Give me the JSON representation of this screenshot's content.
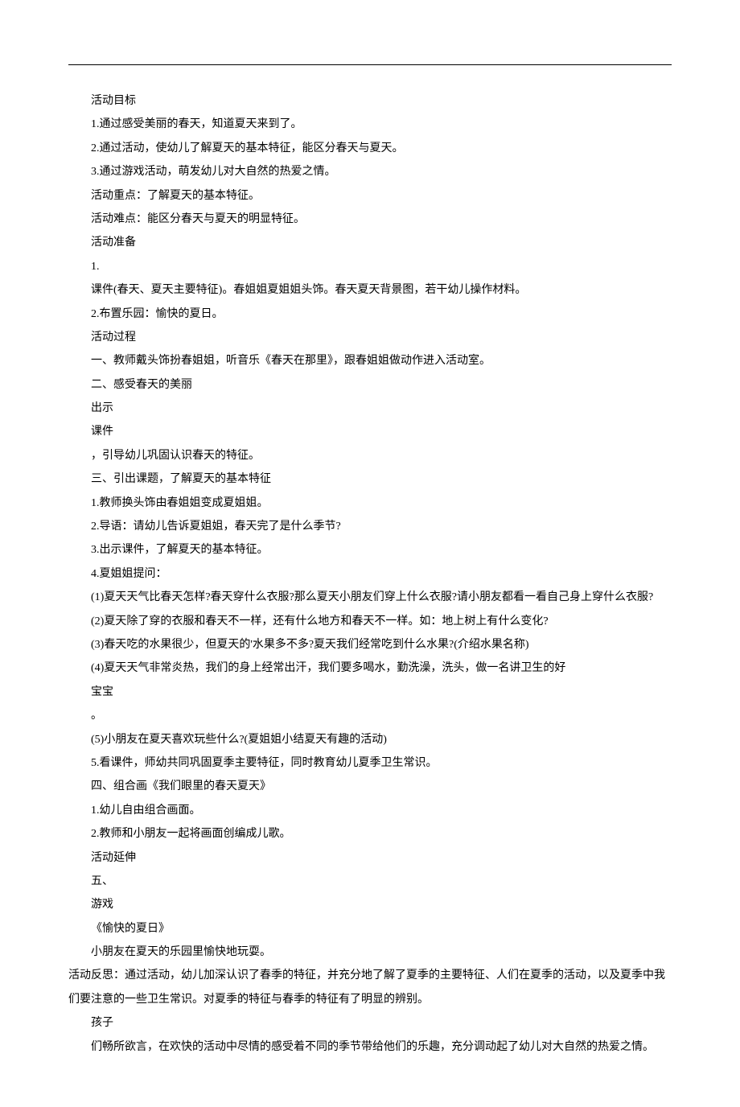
{
  "lines": [
    {
      "indent": true,
      "text": "活动目标"
    },
    {
      "indent": true,
      "text": "1.通过感受美丽的春天，知道夏天来到了。"
    },
    {
      "indent": true,
      "text": "2.通过活动，使幼儿了解夏天的基本特征，能区分春天与夏天。"
    },
    {
      "indent": true,
      "text": "3.通过游戏活动，萌发幼儿对大自然的热爱之情。"
    },
    {
      "indent": true,
      "text": "活动重点：了解夏天的基本特征。"
    },
    {
      "indent": true,
      "text": "活动难点：能区分春天与夏天的明显特征。"
    },
    {
      "indent": true,
      "text": "活动准备"
    },
    {
      "indent": true,
      "text": "1."
    },
    {
      "indent": true,
      "text": "课件(春天、夏天主要特征)。春姐姐夏姐姐头饰。春天夏天背景图，若干幼儿操作材料。"
    },
    {
      "indent": true,
      "text": "2.布置乐园：愉快的夏日。"
    },
    {
      "indent": true,
      "text": "活动过程"
    },
    {
      "indent": true,
      "text": "一、教师戴头饰扮春姐姐，听音乐《春天在那里》，跟春姐姐做动作进入活动室。"
    },
    {
      "indent": true,
      "text": "二、感受春天的美丽"
    },
    {
      "indent": true,
      "text": "出示"
    },
    {
      "indent": true,
      "text": "课件"
    },
    {
      "indent": true,
      "text": "，引导幼儿巩固认识春天的特征。"
    },
    {
      "indent": true,
      "text": "三、引出课题，了解夏天的基本特征"
    },
    {
      "indent": true,
      "text": "1.教师换头饰由春姐姐变成夏姐姐。"
    },
    {
      "indent": true,
      "text": "2.导语：请幼儿告诉夏姐姐，春天完了是什么季节?"
    },
    {
      "indent": true,
      "text": "3.出示课件，了解夏天的基本特征。"
    },
    {
      "indent": true,
      "text": "4.夏姐姐提问："
    },
    {
      "indent": true,
      "text": "(1)夏天天气比春天怎样?春天穿什么衣服?那么夏天小朋友们穿上什么衣服?请小朋友都看一看自己身上穿什么衣服?"
    },
    {
      "indent": true,
      "text": "(2)夏天除了穿的衣服和春天不一样，还有什么地方和春天不一样。如：地上树上有什么变化?"
    },
    {
      "indent": true,
      "text": "(3)春天吃的水果很少，但夏天的'水果多不多?夏天我们经常吃到什么水果?(介绍水果名称)"
    },
    {
      "indent": true,
      "text": "(4)夏天天气非常炎热，我们的身上经常出汗，我们要多喝水，勤洗澡，洗头，做一名讲卫生的好"
    },
    {
      "indent": true,
      "text": "宝宝"
    },
    {
      "indent": true,
      "text": "。"
    },
    {
      "indent": true,
      "text": "(5)小朋友在夏天喜欢玩些什么?(夏姐姐小结夏天有趣的活动)"
    },
    {
      "indent": true,
      "text": "5.看课件，师幼共同巩固夏季主要特征，同时教育幼儿夏季卫生常识。"
    },
    {
      "indent": true,
      "text": "四、组合画《我们眼里的春天夏天》"
    },
    {
      "indent": true,
      "text": "1.幼儿自由组合画面。"
    },
    {
      "indent": true,
      "text": "2.教师和小朋友一起将画面创编成儿歌。"
    },
    {
      "indent": true,
      "text": "活动延伸"
    },
    {
      "indent": true,
      "text": "五、"
    },
    {
      "indent": true,
      "text": "游戏"
    },
    {
      "indent": true,
      "text": "《愉快的夏日》"
    },
    {
      "indent": true,
      "text": "小朋友在夏天的乐园里愉快地玩耍。"
    },
    {
      "indent": true,
      "text": "活动反思：通过活动，幼儿加深认识了春季的特征，并充分地了解了夏季的主要特征、人们在夏季的活动，以及夏季中我们要注意的一些卫生常识。对夏季的特征与春季的特征有了明显的辨别。"
    },
    {
      "indent": true,
      "text": "孩子"
    },
    {
      "indent": true,
      "text": "们畅所欲言，在欢快的活动中尽情的感受着不同的季节带给他们的乐趣，充分调动起了幼儿对大自然的热爱之情。"
    }
  ]
}
